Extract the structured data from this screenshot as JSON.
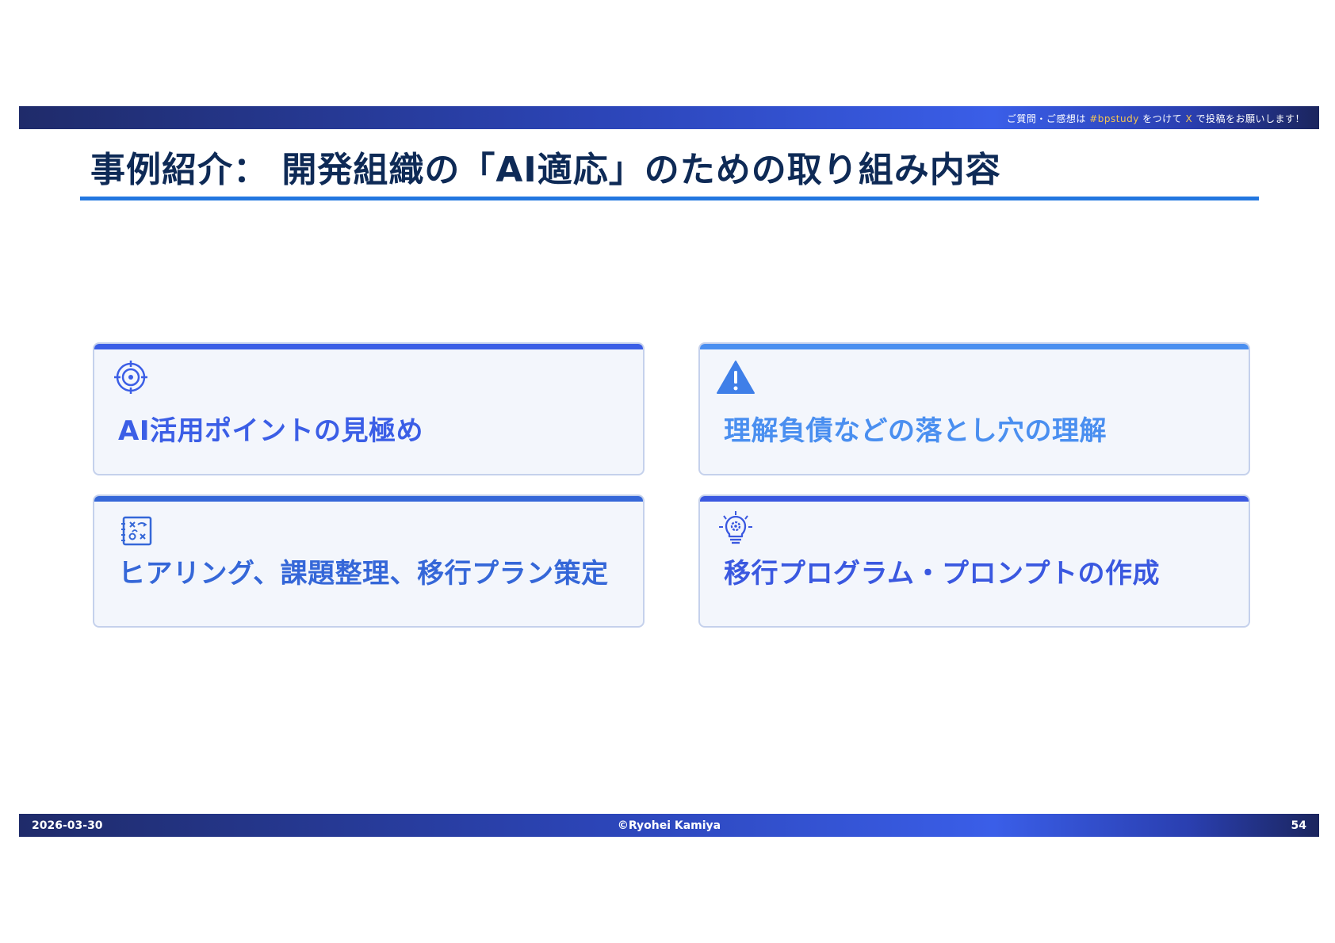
{
  "header": {
    "notice_prefix": "ご質問・ご感想は ",
    "hashtag": "#bpstudy",
    "notice_middle": " をつけて ",
    "platform": "X",
    "notice_suffix": " で投稿をお願いします！"
  },
  "title": "事例紹介： 開発組織の「AI適応」のための取り組み内容",
  "cards": [
    {
      "icon": "target-icon",
      "text": "AI活用ポイントの見極め",
      "accent": "#3b5ee6",
      "text_color": "#3b5ee6"
    },
    {
      "icon": "warning-icon",
      "text": "理解負債などの落とし穴の理解",
      "accent": "#4a8ff0",
      "text_color": "#4a8ff0"
    },
    {
      "icon": "strategy-board-icon",
      "text": "ヒアリング、課題整理、移行プラン策定",
      "accent": "#3567d8",
      "text_color": "#3567d8"
    },
    {
      "icon": "idea-gear-bulb-icon",
      "text": "移行プログラム・プロンプトの作成",
      "accent": "#3a58e0",
      "text_color": "#3a58e0"
    }
  ],
  "footer": {
    "date": "2026-03-30",
    "copyright": "©Ryohei Kamiya",
    "page_number": "54"
  }
}
